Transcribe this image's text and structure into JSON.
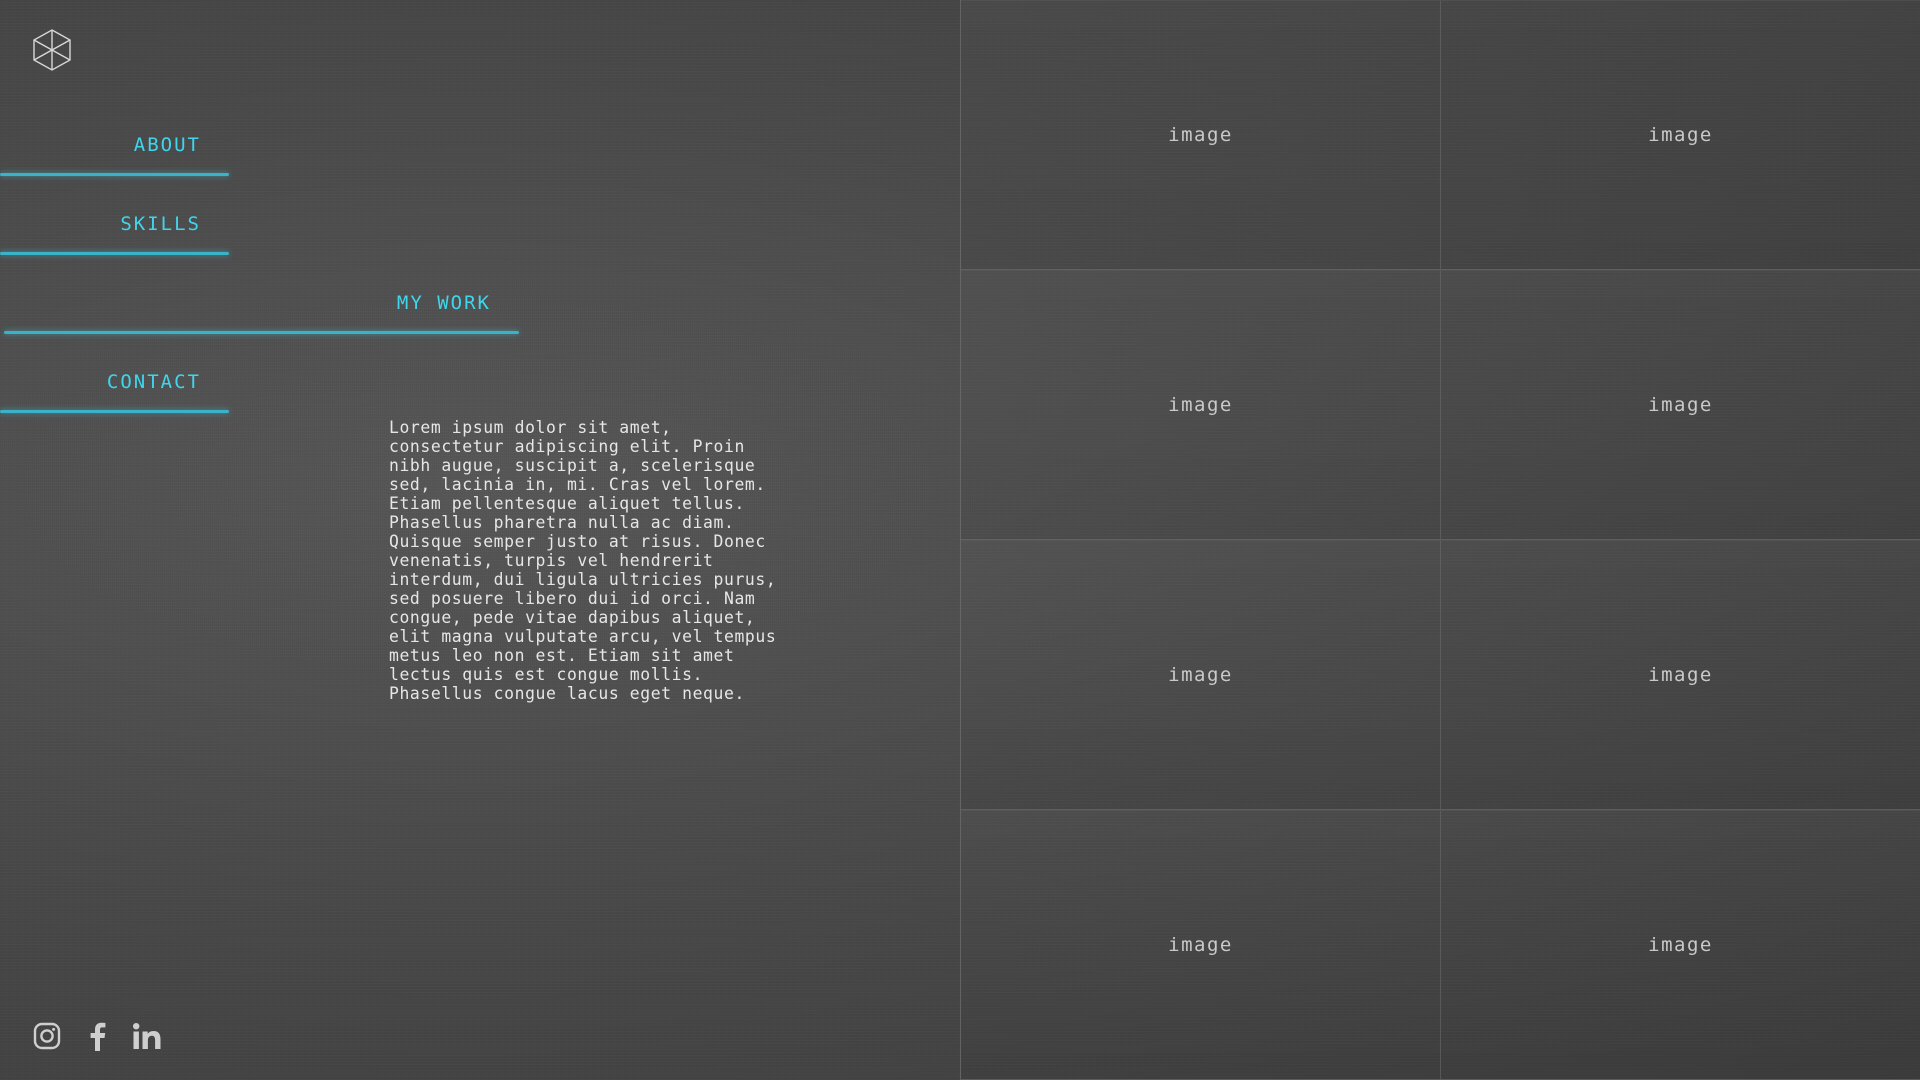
{
  "logo": {
    "icon": "cube-logo-icon"
  },
  "nav": {
    "about": "ABOUT",
    "skills": "SKILLS",
    "work": "MY WORK",
    "contact": "CONTACT"
  },
  "description": "Lorem ipsum dolor sit amet,\nconsectetur adipiscing elit. Proin\nnibh augue, suscipit a, scelerisque\nsed, lacinia in, mi. Cras vel lorem.\nEtiam pellentesque aliquet tellus.\nPhasellus pharetra nulla ac diam.\nQuisque semper justo at risus. Donec\nvenenatis, turpis vel hendrerit\ninterdum, dui ligula ultricies purus,\nsed posuere libero dui id orci. Nam\ncongue, pede vitae dapibus aliquet,\nelit magna vulputate arcu, vel tempus\nmetus leo non est. Etiam sit amet\nlectus quis est congue mollis.\nPhasellus congue lacus eget neque.",
  "grid": {
    "cells": [
      "image",
      "image",
      "image",
      "image",
      "image",
      "image",
      "image",
      "image"
    ]
  },
  "social": {
    "icons": [
      "instagram-icon",
      "facebook-icon",
      "linkedin-icon"
    ]
  },
  "colors": {
    "accent": "#3fd6ec",
    "background": "#4a4a4a",
    "text": "#e6e6e6"
  }
}
